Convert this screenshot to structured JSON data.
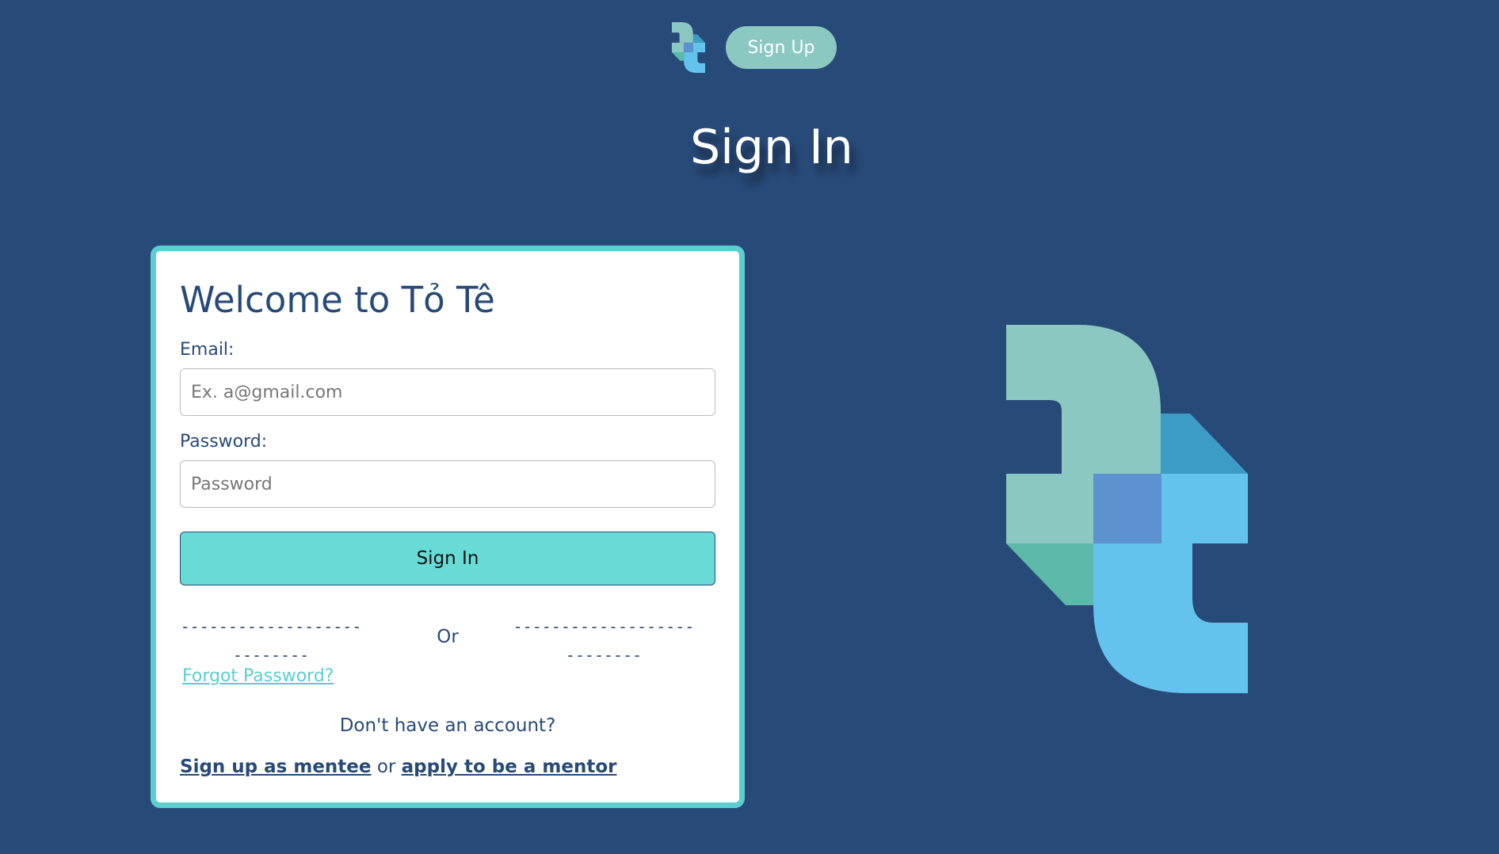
{
  "nav": {
    "logo_icon": "tote-logo-icon",
    "signup_label": "Sign Up"
  },
  "page": {
    "title": "Sign In"
  },
  "card": {
    "title": "Welcome to Tỏ Tê",
    "email_label": "Email:",
    "email_placeholder": "Ex. a@gmail.com",
    "email_value": "",
    "password_label": "Password:",
    "password_placeholder": "Password",
    "password_value": "",
    "signin_label": "Sign In",
    "divider_left": "---------------------------",
    "divider_right": "---------------------------",
    "or_label": "Or",
    "forgot_label": "Forgot Password?",
    "no_account_text": "Don't have an account?",
    "mentee_link": "Sign up as mentee",
    "or_connector": "or",
    "mentor_link": "apply to be a mentor"
  },
  "colors": {
    "background": "#284a78",
    "accent_teal": "#68dbd6",
    "card_border": "#5ccdd0",
    "signup_pill": "#8ac8c1",
    "logo_sage": "#8ac8c1",
    "logo_blue": "#63c3ec",
    "logo_mid_blue": "#5b92cf",
    "logo_dark_teal": "#3d9cc5",
    "logo_green": "#5cb8a8"
  },
  "hero": {
    "logo_icon": "tote-large-logo-icon"
  }
}
